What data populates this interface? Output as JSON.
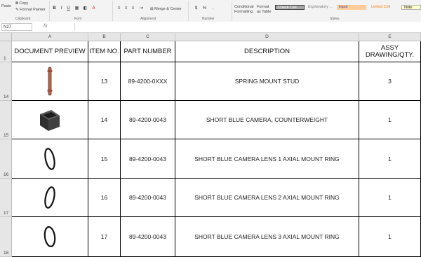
{
  "ribbon": {
    "clipboard": {
      "paste_label": "Paste",
      "copy_label": "Copy",
      "format_painter_label": "Format Painter",
      "group_label": "Clipboard"
    },
    "font": {
      "group_label": "Font",
      "bold": "B",
      "italic": "I",
      "underline": "U"
    },
    "alignment": {
      "merge_label": "Merge & Center",
      "group_label": "Alignment"
    },
    "number": {
      "group_label": "Number",
      "currency": "$",
      "percent": "%"
    },
    "styles": {
      "conditional_formatting_label": "Conditional Formatting",
      "format_as_table_label": "Format as Table",
      "group_label": "Styles",
      "check_cell": "Check Cell",
      "explanatory": "Explanatory ...",
      "input": "Input",
      "linked_cell": "Linked Cell",
      "note": "Note"
    }
  },
  "formula_bar": {
    "name_box": "N27",
    "fx": "fx",
    "content": ""
  },
  "columns": [
    "A",
    "B",
    "C",
    "D",
    "E"
  ],
  "header_row": {
    "number": "1",
    "cells": [
      "DOCUMENT PREVIEW",
      "ITEM NO.",
      "PART NUMBER",
      "DESCRIPTION",
      "ASSY DRAWING/QTY."
    ]
  },
  "rows": [
    {
      "row": "14",
      "item": "13",
      "part": "89-4200-0XXX",
      "description": "SPRING MOUNT STUD",
      "qty": "3",
      "preview": "stud"
    },
    {
      "row": "15",
      "item": "14",
      "part": "89-4200-0043",
      "description": "SHORT BLUE CAMERA, COUNTERWEIGHT",
      "qty": "1",
      "preview": "block"
    },
    {
      "row": "16",
      "item": "15",
      "part": "89-4200-0043",
      "description": "SHORT BLUE CAMERA LENS 1 AXIAL MOUNT RING",
      "qty": "1",
      "preview": "ring"
    },
    {
      "row": "17",
      "item": "16",
      "part": "89-4200-0043",
      "description": "SHORT BLUE CAMERA LENS 2 AXIAL MOUNT RING",
      "qty": "1",
      "preview": "ring"
    },
    {
      "row": "18",
      "item": "17",
      "part": "89-4200-0043",
      "description": "SHORT BLUE CAMERA LENS 3 AXIAL MOUNT RING",
      "qty": "1",
      "preview": "ring"
    }
  ]
}
